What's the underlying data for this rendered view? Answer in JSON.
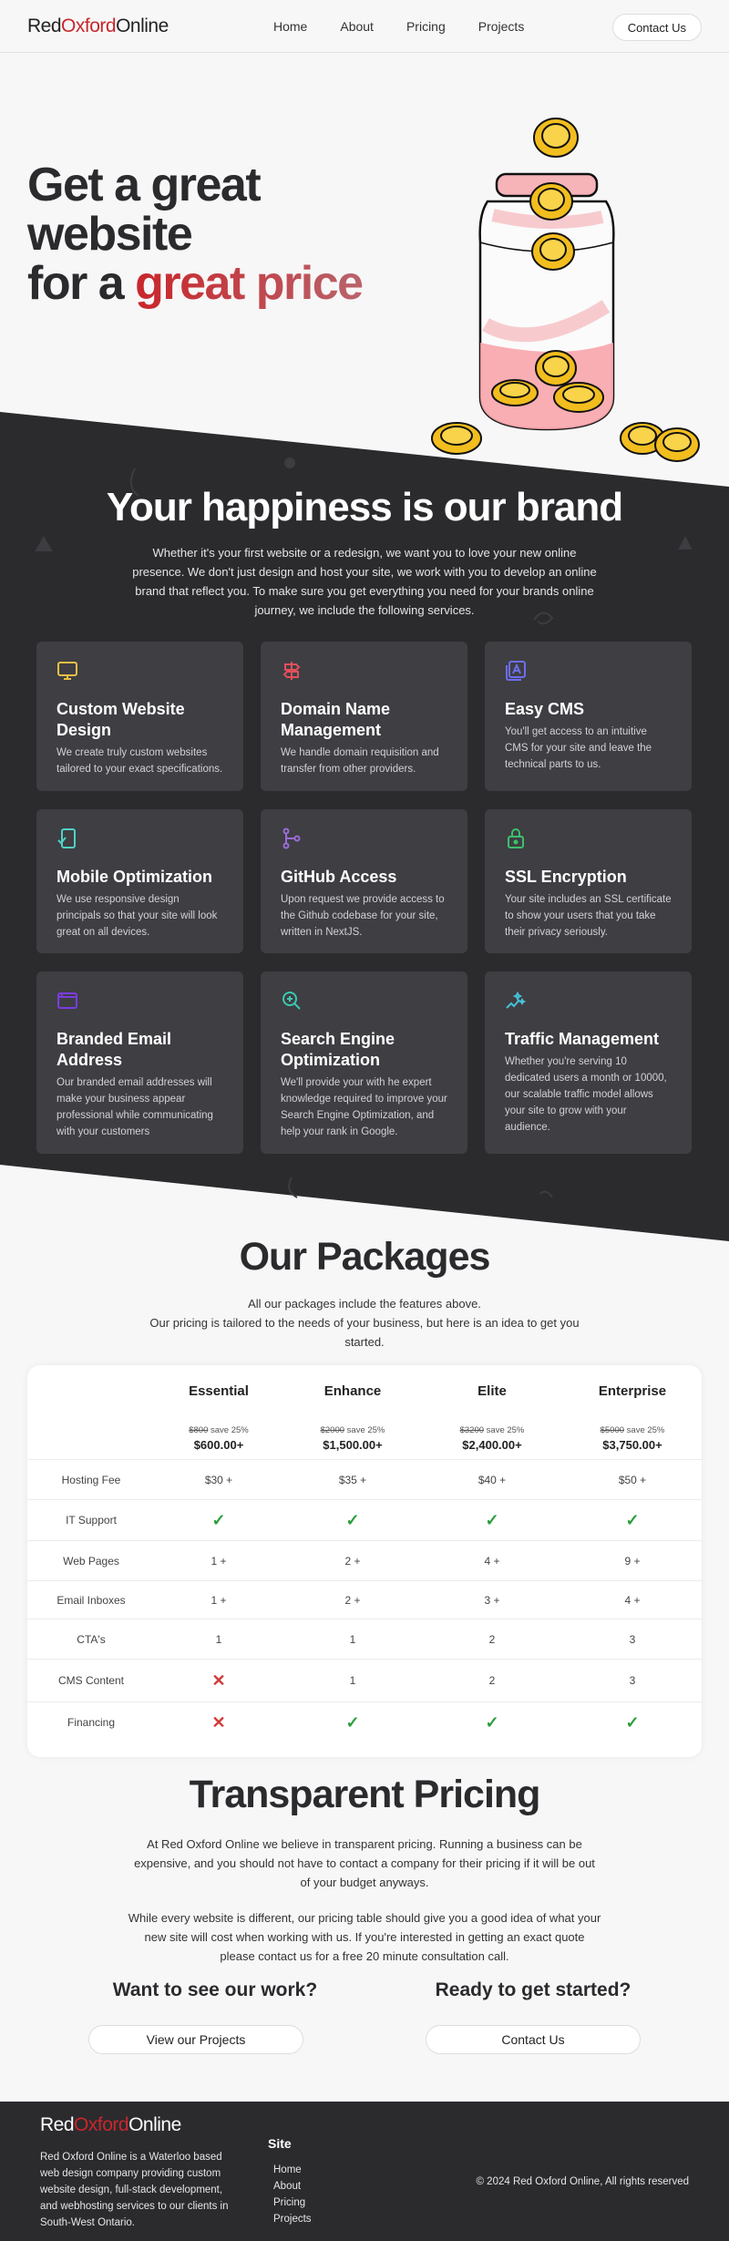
{
  "nav": {
    "logo_part1": "Red",
    "logo_part2": "Oxford",
    "logo_part3": "Online",
    "links": [
      "Home",
      "About",
      "Pricing",
      "Projects"
    ],
    "contact": "Contact Us"
  },
  "hero": {
    "line1": "Get a great",
    "line2": "website",
    "line3_prefix": "for a ",
    "line3_accent": "great price"
  },
  "services": {
    "title": "Your happiness is our brand",
    "description": "Whether it's your first website or a redesign, we want you to love your new online presence. We don't just design and host your site, we work with you to develop an online brand that reflect you. To make sure you get everything you need for your brands online journey, we include the following services.",
    "cards": [
      {
        "title": "Custom Website Design",
        "text": "We create truly custom websites tailored to your exact specifications.",
        "icon": "monitor-icon",
        "color": "#e8c043"
      },
      {
        "title": "Domain Name Management",
        "text": "We handle domain requisition and transfer from other providers.",
        "icon": "signpost-icon",
        "color": "#e0505a"
      },
      {
        "title": "Easy CMS",
        "text": "You'll get access to an intuitive CMS for your site and leave the technical parts to us.",
        "icon": "cms-icon",
        "color": "#6d6df0"
      },
      {
        "title": "Mobile Optimization",
        "text": "We use responsive design principals so that your site will look great on all devices.",
        "icon": "mobile-check-icon",
        "color": "#4fd1c5"
      },
      {
        "title": "GitHub Access",
        "text": "Upon request we provide access to the Github codebase for your site, written in NextJS.",
        "icon": "git-branch-icon",
        "color": "#9b6bd6"
      },
      {
        "title": "SSL Encryption",
        "text": "Your site includes an SSL certificate to show your users that you take their privacy seriously.",
        "icon": "lock-icon",
        "color": "#3cc06a"
      },
      {
        "title": "Branded Email Address",
        "text": "Our branded email addresses will make your business appear professional while communicating with your customers",
        "icon": "mail-icon",
        "color": "#7a3ce0"
      },
      {
        "title": "Search Engine Optimization",
        "text": "We'll provide your with he expert knowledge required to improve your Search Engine Optimization, and help your rank in Google.",
        "icon": "search-icon",
        "color": "#3cc9b0"
      },
      {
        "title": "Traffic Management",
        "text": "Whether you're serving 10 dedicated users a month or 10000, our scalable traffic model allows your site to grow with your audience.",
        "icon": "traffic-sparkle-icon",
        "color": "#48c0d8"
      }
    ]
  },
  "packages": {
    "title": "Our Packages",
    "desc1": "All our packages include the features above.",
    "desc2": "Our pricing is tailored to the needs of your business, but here is an idea to get you started.",
    "tiers": [
      {
        "name": "Essential",
        "old": "$800",
        "save": "save 25%",
        "price": "$600.00+"
      },
      {
        "name": "Enhance",
        "old": "$2000",
        "save": "save 25%",
        "price": "$1,500.00+"
      },
      {
        "name": "Elite",
        "old": "$3200",
        "save": "save 25%",
        "price": "$2,400.00+"
      },
      {
        "name": "Enterprise",
        "old": "$5000",
        "save": "save 25%",
        "price": "$3,750.00+"
      }
    ],
    "rows": [
      {
        "label": "Hosting Fee",
        "cells": [
          "$30 +",
          "$35 +",
          "$40 +",
          "$50 +"
        ]
      },
      {
        "label": "IT Support",
        "cells": [
          "check",
          "check",
          "check",
          "check"
        ]
      },
      {
        "label": "Web Pages",
        "cells": [
          "1 +",
          "2 +",
          "4 +",
          "9 +"
        ]
      },
      {
        "label": "Email Inboxes",
        "cells": [
          "1 +",
          "2 +",
          "3 +",
          "4 +"
        ]
      },
      {
        "label": "CTA's",
        "cells": [
          "1",
          "1",
          "2",
          "3"
        ]
      },
      {
        "label": "CMS Content",
        "cells": [
          "cross",
          "1",
          "2",
          "3"
        ]
      },
      {
        "label": "Financing",
        "cells": [
          "cross",
          "check",
          "check",
          "check"
        ]
      }
    ]
  },
  "transparent": {
    "title": "Transparent Pricing",
    "p1": "At Red Oxford Online we believe in transparent pricing. Running a business can be expensive, and you should not have to contact a company for their pricing if it will be out of your budget anyways.",
    "p2": "While every website is different, our pricing table should give you a good idea of what your new site will cost when working with us. If you're interested in getting an exact quote please contact us for a free 20 minute consultation call.",
    "cta_left_heading": "Want to see our work?",
    "cta_left_button": "View our Projects",
    "cta_right_heading": "Ready to get started?",
    "cta_right_button": "Contact Us"
  },
  "footer": {
    "logo_part1": "Red",
    "logo_part2": "Oxford",
    "logo_part3": "Online",
    "description": "Red Oxford Online is a Waterloo based web design company providing custom website design, full-stack development, and webhosting services to our clients in South-West Ontario.",
    "site_heading": "Site",
    "links": [
      "Home",
      "About",
      "Pricing",
      "Projects"
    ],
    "copyright": "© 2024 Red Oxford Online, All rights reserved"
  }
}
